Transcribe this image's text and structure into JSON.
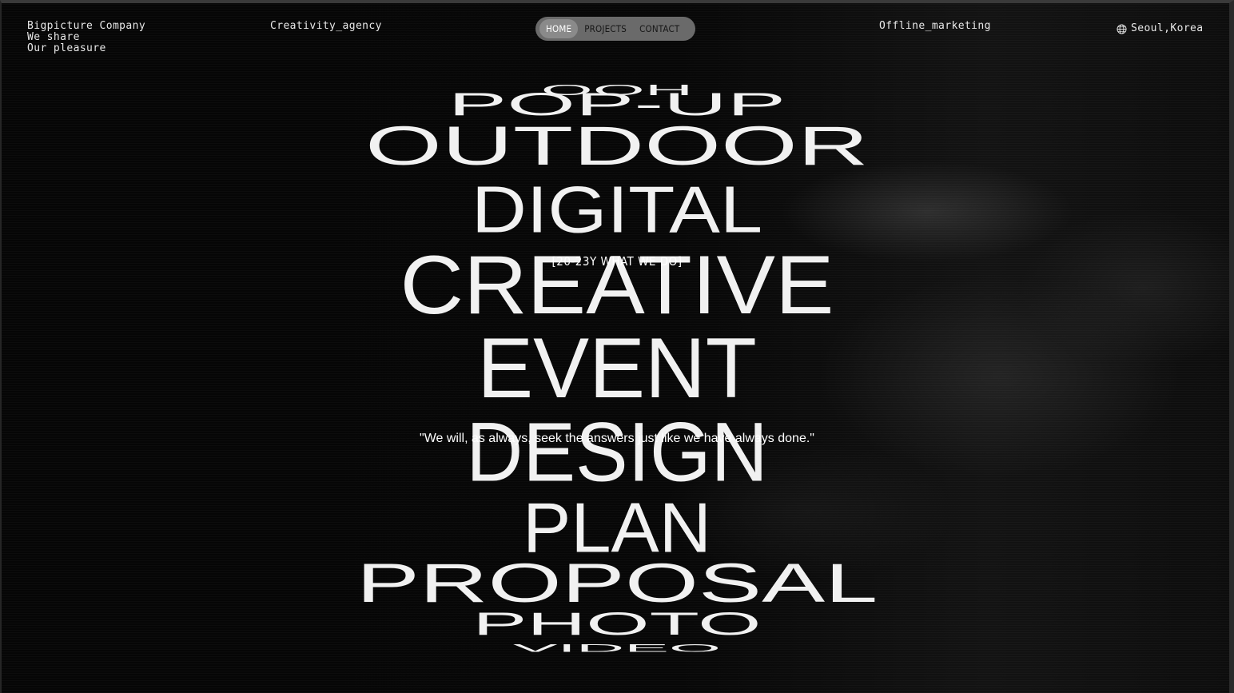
{
  "header": {
    "company_lines": [
      "Bigpicture Company",
      "We share",
      "Our pleasure"
    ],
    "tagline": "Creativity_agency",
    "specialty": "Offline_marketing",
    "location": "Seoul,Korea",
    "location_icon": "globe-icon"
  },
  "nav": {
    "items": [
      {
        "label": "HOME",
        "active": true
      },
      {
        "label": "PROJECTS",
        "active": false
      },
      {
        "label": "CONTACT",
        "active": false
      }
    ]
  },
  "services": {
    "words": [
      "OOH",
      "POP-UP",
      "OUTDOOR",
      "DIGITAL",
      "CREATIVE",
      "EVENT",
      "DESIGN",
      "PLAN",
      "PROPOSAL",
      "PHOTO",
      "VIDEO"
    ]
  },
  "overlay": {
    "label": "[20-23Y WHAT WE DO]",
    "quote": "\"We will, as always, seek the answers just like we have always done.\""
  },
  "colors": {
    "background": "#050505",
    "text": "#f1f1f1",
    "nav_pill": "#6a6a6a",
    "nav_active": "#8a8a8a"
  }
}
